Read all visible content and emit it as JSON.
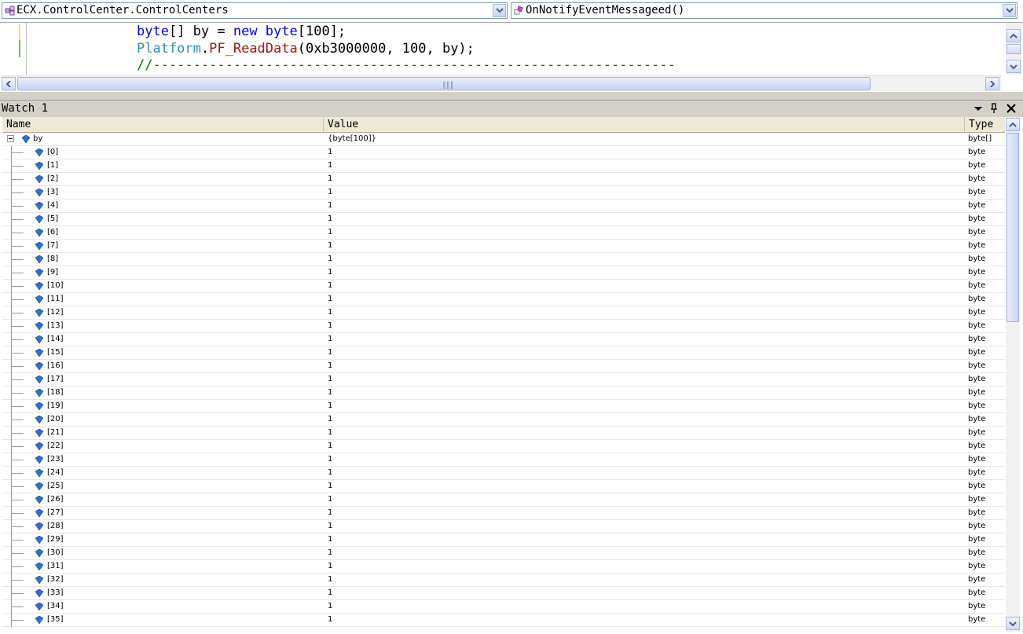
{
  "navbar": {
    "type_combo": "ECX.ControlCenter.ControlCenters",
    "member_combo": "OnNotifyEventMessageed()"
  },
  "editor": {
    "line1": {
      "kw1": "byte",
      "rest1": "[] by = ",
      "kw2": "new",
      "kw3": " byte",
      "rest2": "[100];"
    },
    "line2": {
      "cls": "Platform",
      "dot": ".",
      "mt": "PF_ReadData",
      "args": "(0xb3000000, 100, by);"
    },
    "line3": {
      "cm": "//-----------------------------------------------------------------"
    }
  },
  "watch": {
    "title": "Watch 1",
    "columns": {
      "name": "Name",
      "value": "Value",
      "type": "Type"
    },
    "root": {
      "name": "by",
      "value": "{byte[100]}",
      "type": "byte[]"
    },
    "items": [
      {
        "name": "[0]",
        "value": "1",
        "type": "byte"
      },
      {
        "name": "[1]",
        "value": "1",
        "type": "byte"
      },
      {
        "name": "[2]",
        "value": "1",
        "type": "byte"
      },
      {
        "name": "[3]",
        "value": "1",
        "type": "byte"
      },
      {
        "name": "[4]",
        "value": "1",
        "type": "byte"
      },
      {
        "name": "[5]",
        "value": "1",
        "type": "byte"
      },
      {
        "name": "[6]",
        "value": "1",
        "type": "byte"
      },
      {
        "name": "[7]",
        "value": "1",
        "type": "byte"
      },
      {
        "name": "[8]",
        "value": "1",
        "type": "byte"
      },
      {
        "name": "[9]",
        "value": "1",
        "type": "byte"
      },
      {
        "name": "[10]",
        "value": "1",
        "type": "byte"
      },
      {
        "name": "[11]",
        "value": "1",
        "type": "byte"
      },
      {
        "name": "[12]",
        "value": "1",
        "type": "byte"
      },
      {
        "name": "[13]",
        "value": "1",
        "type": "byte"
      },
      {
        "name": "[14]",
        "value": "1",
        "type": "byte"
      },
      {
        "name": "[15]",
        "value": "1",
        "type": "byte"
      },
      {
        "name": "[16]",
        "value": "1",
        "type": "byte"
      },
      {
        "name": "[17]",
        "value": "1",
        "type": "byte"
      },
      {
        "name": "[18]",
        "value": "1",
        "type": "byte"
      },
      {
        "name": "[19]",
        "value": "1",
        "type": "byte"
      },
      {
        "name": "[20]",
        "value": "1",
        "type": "byte"
      },
      {
        "name": "[21]",
        "value": "1",
        "type": "byte"
      },
      {
        "name": "[22]",
        "value": "1",
        "type": "byte"
      },
      {
        "name": "[23]",
        "value": "1",
        "type": "byte"
      },
      {
        "name": "[24]",
        "value": "1",
        "type": "byte"
      },
      {
        "name": "[25]",
        "value": "1",
        "type": "byte"
      },
      {
        "name": "[26]",
        "value": "1",
        "type": "byte"
      },
      {
        "name": "[27]",
        "value": "1",
        "type": "byte"
      },
      {
        "name": "[28]",
        "value": "1",
        "type": "byte"
      },
      {
        "name": "[29]",
        "value": "1",
        "type": "byte"
      },
      {
        "name": "[30]",
        "value": "1",
        "type": "byte"
      },
      {
        "name": "[31]",
        "value": "1",
        "type": "byte"
      },
      {
        "name": "[32]",
        "value": "1",
        "type": "byte"
      },
      {
        "name": "[33]",
        "value": "1",
        "type": "byte"
      },
      {
        "name": "[34]",
        "value": "1",
        "type": "byte"
      },
      {
        "name": "[35]",
        "value": "1",
        "type": "byte"
      }
    ]
  },
  "colors": {
    "keyword": "#0000ff",
    "class": "#2b91af",
    "method": "#a31515",
    "comment": "#008000"
  },
  "icons": {
    "type_combo": "class-icon",
    "member_combo": "event-method-icon",
    "variable": "field-icon"
  }
}
